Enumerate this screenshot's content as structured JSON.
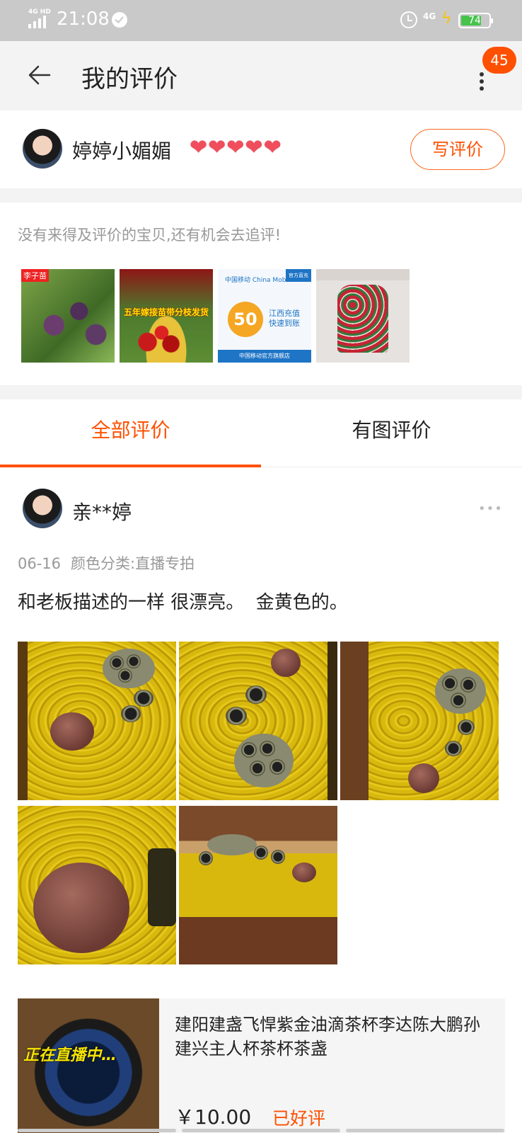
{
  "status_bar": {
    "network": "4G HD",
    "time": "21:08",
    "network_right": "4G",
    "battery": "74",
    "battery_level": 0.74
  },
  "header": {
    "title": "我的评价",
    "notification_count": "45"
  },
  "profile": {
    "name": "婷婷小媚媚",
    "heart_count": 5,
    "write_button": "写评价"
  },
  "pending": {
    "tip": "没有来得及评价的宝贝,还有机会去追评!",
    "items": [
      {
        "tag": "李子苗"
      },
      {
        "banner": "五年嫁接苗带分枝发货"
      },
      {
        "brand": "中国移动 China Mobile",
        "badge": "官方直充",
        "amount": "50",
        "text": "江西充值\n快速到账",
        "store": "中国移动官方旗舰店"
      },
      {}
    ]
  },
  "tabs": {
    "all": "全部评价",
    "with_photos": "有图评价",
    "active": "all"
  },
  "review": {
    "reviewer": "亲**婷",
    "date": "06-16",
    "variant": "颜色分类:直播专拍",
    "text": "和老板描述的一样 很漂亮。  金黄色的。",
    "photo_count": 5
  },
  "product": {
    "overlay": "正在直播中…",
    "title": "建阳建盏飞悍紫金油滴茶杯李达陈大鹏孙建兴主人杯茶杯茶盏",
    "price": "￥10.00",
    "status": "已好评"
  },
  "colors": {
    "accent": "#ff5000",
    "background_gray": "#f3f3f3",
    "muted_text": "#999999"
  }
}
